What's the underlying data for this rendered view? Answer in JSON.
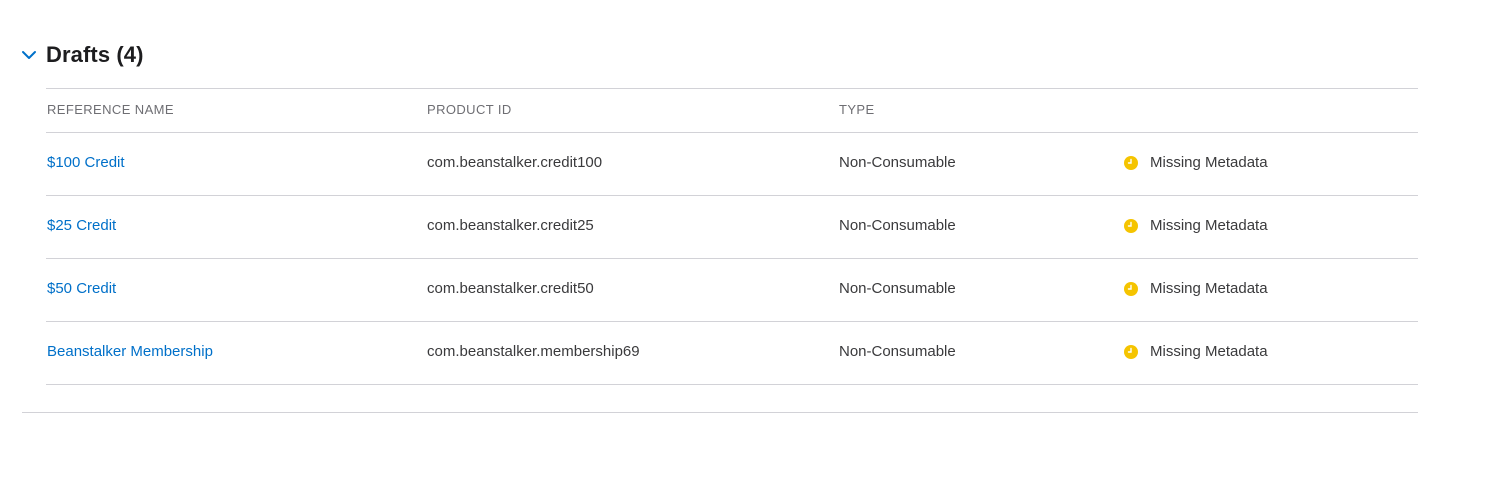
{
  "section": {
    "title": "Drafts (4)"
  },
  "colors": {
    "link": "#0070c9",
    "status_warning": "#f5c400",
    "chevron": "#0070c9",
    "divider": "#d2d2d7"
  },
  "table": {
    "columns": [
      "REFERENCE NAME",
      "PRODUCT ID",
      "TYPE"
    ],
    "rows": [
      {
        "reference_name": "$100 Credit",
        "product_id": "com.beanstalker.credit100",
        "type": "Non-Consumable",
        "status": "Missing Metadata",
        "status_icon": "clock-icon"
      },
      {
        "reference_name": "$25 Credit",
        "product_id": "com.beanstalker.credit25",
        "type": "Non-Consumable",
        "status": "Missing Metadata",
        "status_icon": "clock-icon"
      },
      {
        "reference_name": "$50 Credit",
        "product_id": "com.beanstalker.credit50",
        "type": "Non-Consumable",
        "status": "Missing Metadata",
        "status_icon": "clock-icon"
      },
      {
        "reference_name": "Beanstalker Membership",
        "product_id": "com.beanstalker.membership69",
        "type": "Non-Consumable",
        "status": "Missing Metadata",
        "status_icon": "clock-icon"
      }
    ]
  }
}
